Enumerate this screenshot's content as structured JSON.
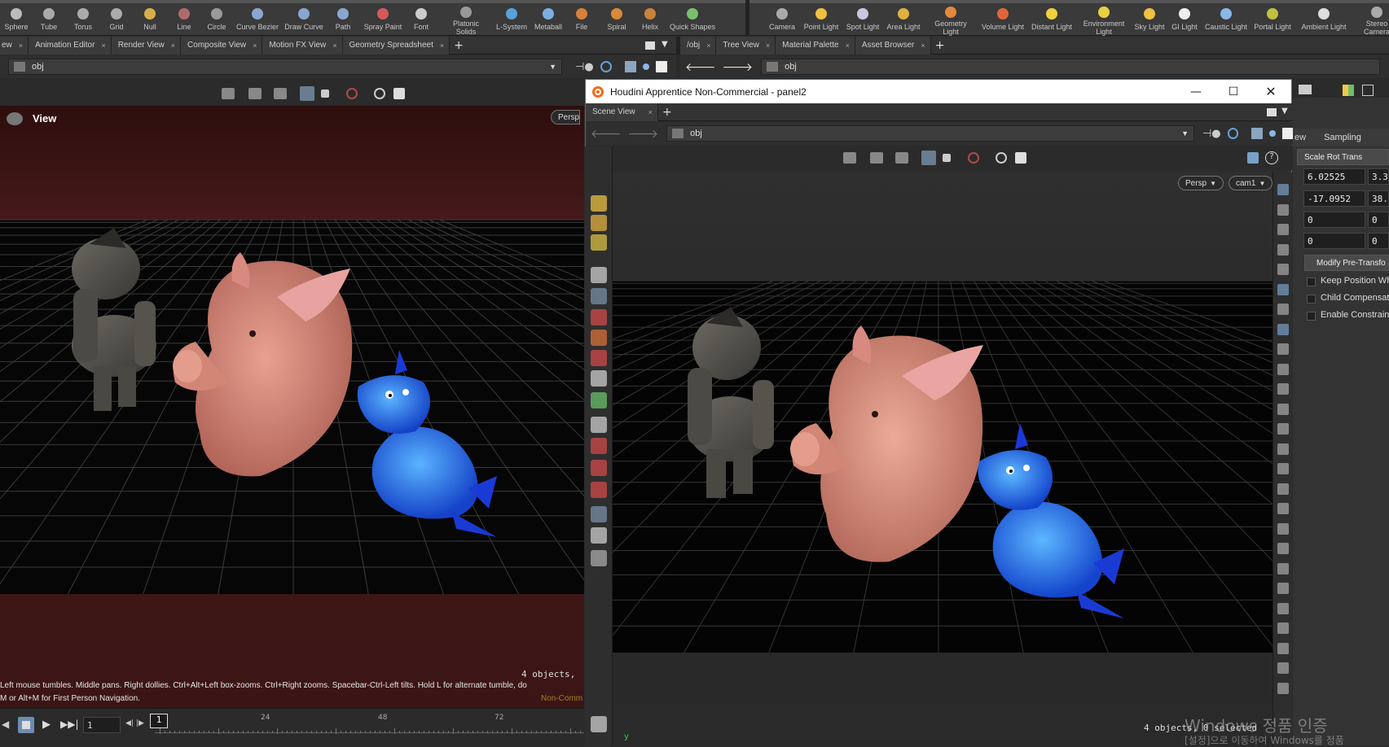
{
  "shelf": {
    "left_tools": [
      {
        "label": "Sphere",
        "icon": "sphere-icon"
      },
      {
        "label": "Tube",
        "icon": "tube-icon"
      },
      {
        "label": "Torus",
        "icon": "torus-icon"
      },
      {
        "label": "Grid",
        "icon": "grid-icon"
      },
      {
        "label": "Null",
        "icon": "null-icon"
      },
      {
        "label": "Line",
        "icon": "line-icon"
      },
      {
        "label": "Circle",
        "icon": "circle-icon"
      },
      {
        "label": "Curve Bezier",
        "icon": "curve-bezier-icon"
      },
      {
        "label": "Draw Curve",
        "icon": "draw-curve-icon"
      },
      {
        "label": "Path",
        "icon": "path-icon"
      },
      {
        "label": "Spray Paint",
        "icon": "spray-paint-icon"
      },
      {
        "label": "Font",
        "icon": "font-icon"
      },
      {
        "label": "Platonic\nSolids",
        "icon": "platonic-solids-icon"
      },
      {
        "label": "L-System",
        "icon": "l-system-icon"
      },
      {
        "label": "Metaball",
        "icon": "metaball-icon"
      },
      {
        "label": "File",
        "icon": "file-icon"
      },
      {
        "label": "Spiral",
        "icon": "spiral-icon"
      },
      {
        "label": "Helix",
        "icon": "helix-icon"
      },
      {
        "label": "Quick Shapes",
        "icon": "quick-shapes-icon"
      }
    ],
    "right_tools": [
      {
        "label": "Camera",
        "icon": "camera-icon"
      },
      {
        "label": "Point Light",
        "icon": "point-light-icon"
      },
      {
        "label": "Spot Light",
        "icon": "spot-light-icon"
      },
      {
        "label": "Area Light",
        "icon": "area-light-icon"
      },
      {
        "label": "Geometry\nLight",
        "icon": "geometry-light-icon"
      },
      {
        "label": "Volume Light",
        "icon": "volume-light-icon"
      },
      {
        "label": "Distant Light",
        "icon": "distant-light-icon"
      },
      {
        "label": "Environment\nLight",
        "icon": "environment-light-icon"
      },
      {
        "label": "Sky Light",
        "icon": "sky-light-icon"
      },
      {
        "label": "GI Light",
        "icon": "gi-light-icon"
      },
      {
        "label": "Caustic Light",
        "icon": "caustic-light-icon"
      },
      {
        "label": "Portal Light",
        "icon": "portal-light-icon"
      },
      {
        "label": "Ambient Light",
        "icon": "ambient-light-icon"
      },
      {
        "label": "Stereo\nCamera",
        "icon": "stereo-camera-icon"
      }
    ]
  },
  "left_panel": {
    "tabs": [
      {
        "label": "ew"
      },
      {
        "label": "Animation Editor"
      },
      {
        "label": "Render View"
      },
      {
        "label": "Composite View"
      },
      {
        "label": "Motion FX View"
      },
      {
        "label": "Geometry Spreadsheet"
      }
    ],
    "path": "obj",
    "viewport_title": "View",
    "persp_label": "Persp",
    "objects_badge": "4 objects,",
    "hint_line1": "Left mouse tumbles. Middle pans. Right dollies. Ctrl+Alt+Left box-zooms. Ctrl+Right zooms. Spacebar-Ctrl-Left tilts. Hold L for alternate tumble, do",
    "hint_line2": "M or Alt+M for First Person Navigation.",
    "noncommercial": "Non-Comm"
  },
  "right_panel": {
    "tabs": [
      {
        "label": "/obj"
      },
      {
        "label": "Tree View"
      },
      {
        "label": "Material Palette"
      },
      {
        "label": "Asset Browser"
      }
    ],
    "path": "obj"
  },
  "window": {
    "title": "Houdini Apprentice Non-Commercial - panel2",
    "tab_label": "Scene View",
    "path": "obj",
    "persp_label": "Persp",
    "camera_label": "cam1",
    "objects_badge": "4 objects, 0 selected",
    "axis_label": "y"
  },
  "timeline": {
    "frame_field": "1",
    "current_frame": "1",
    "ticks": [
      "24",
      "48",
      "72"
    ]
  },
  "params": {
    "tab_partial": "ew",
    "tab_sampling": "Sampling",
    "transform_order": "Scale Rot Trans",
    "row1": [
      "6.02525",
      "3.3"
    ],
    "row2": [
      "-17.0952",
      "38."
    ],
    "row3": [
      "0",
      "0"
    ],
    "row4": [
      "0",
      "0"
    ],
    "modify_button": "Modify Pre-Transfo",
    "checkboxes": [
      "Keep Position Wh",
      "Child Compensat",
      "Enable Constrain"
    ]
  },
  "watermark": {
    "line1": "Windows 정품 인증",
    "line2": "[설정]으로 이동하여 Windows를 정품"
  },
  "colors": {
    "viewport_bg_left": "#3a1414",
    "viewport_floor": "#050505",
    "title_bar": "#ffffff",
    "accent_blue": "#4a6b8c"
  }
}
